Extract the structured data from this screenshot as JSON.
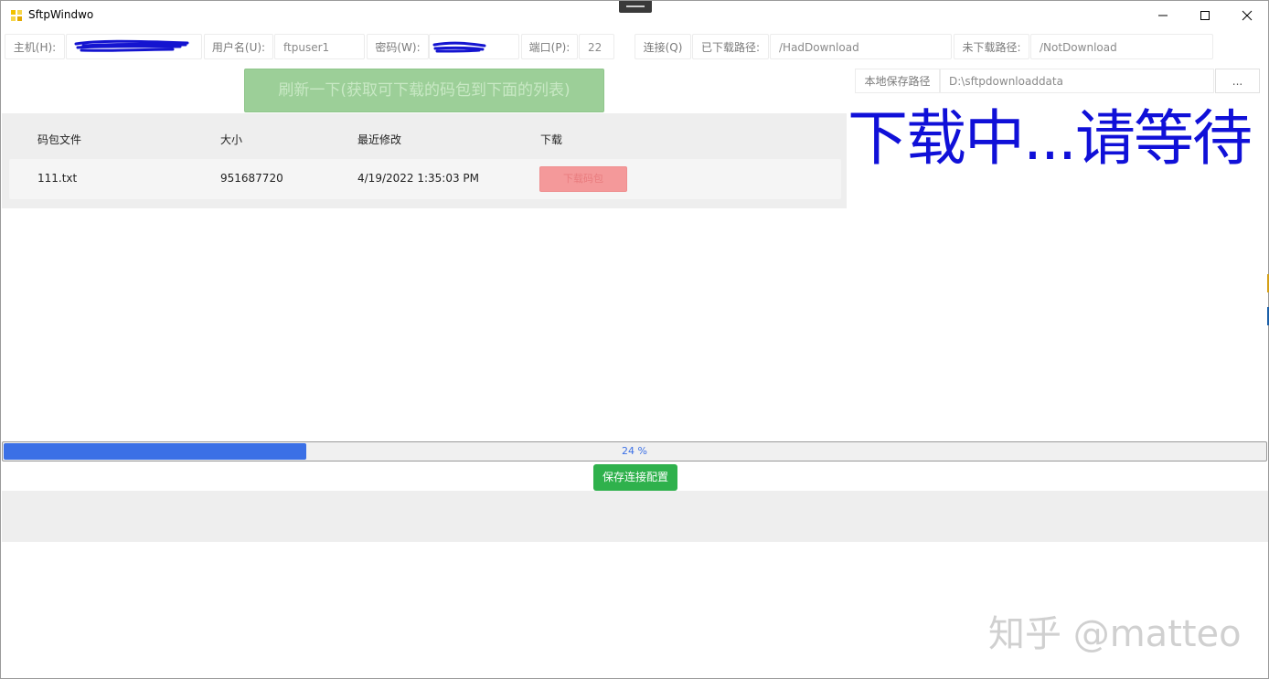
{
  "window": {
    "title": "SftpWindwo"
  },
  "connection": {
    "host_label": "主机(H):",
    "host_value": "",
    "user_label": "用户名(U):",
    "user_value": "ftpuser1",
    "password_label": "密码(W):",
    "password_value": "",
    "port_label": "端口(P):",
    "port_value": "22",
    "connect_label": "连接(Q)",
    "downloaded_path_label": "已下载路径:",
    "downloaded_path_value": "/HadDownload",
    "not_downloaded_path_label": "未下载路径:",
    "not_downloaded_path_value": "/NotDownload"
  },
  "refresh_button": "刷新一下(获取可下载的码包到下面的列表)",
  "local_path": {
    "label": "本地保存路径",
    "value": "D:\\sftpdownloaddata",
    "browse_label": "..."
  },
  "status_message": "下载中...请等待",
  "file_table": {
    "headers": [
      "码包文件",
      "大小",
      "最近修改",
      "下载"
    ],
    "rows": [
      {
        "name": "111.txt",
        "size": "951687720",
        "modified": "4/19/2022 1:35:03 PM",
        "action": "下载码包"
      }
    ]
  },
  "progress": {
    "percent": 24,
    "label": "24 %"
  },
  "save_button": "保存连接配置",
  "watermark": "知乎 @matteo",
  "colors": {
    "accent_blue": "#3b70e6",
    "status_blue": "#1010d8",
    "save_green": "#2fb14c",
    "refresh_green": "#9ccf98",
    "download_red": "#f4999a"
  },
  "icons": {
    "app": "app-icon",
    "minimize": "minimize-icon",
    "maximize": "maximize-icon",
    "close": "close-icon"
  }
}
